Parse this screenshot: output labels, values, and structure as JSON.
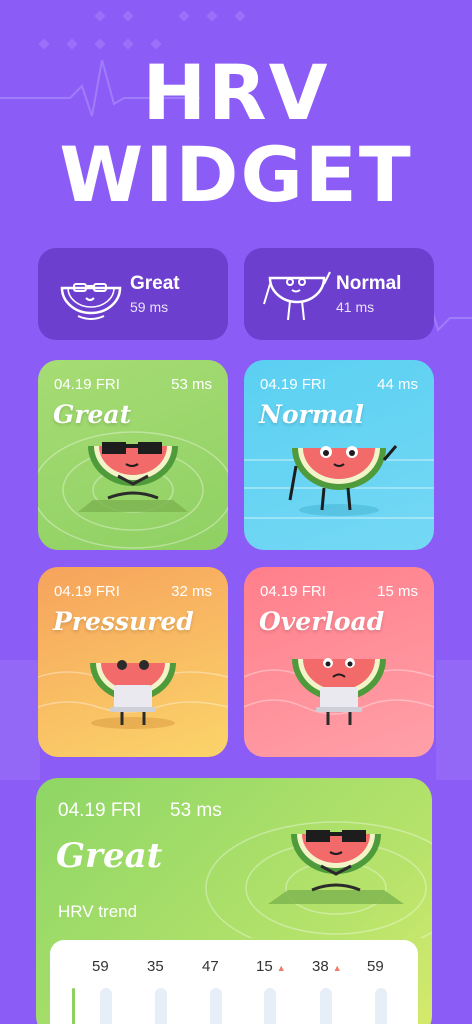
{
  "title_line1": "HRV",
  "title_line2": "WIDGET",
  "summary_cards": [
    {
      "label": "Great",
      "value": "59 ms"
    },
    {
      "label": "Normal",
      "value": "41 ms"
    }
  ],
  "tiles": [
    {
      "date": "04.19 FRI",
      "ms": "53 ms",
      "status": "Great"
    },
    {
      "date": "04.19 FRI",
      "ms": "44 ms",
      "status": "Normal"
    },
    {
      "date": "04.19 FRI",
      "ms": "32 ms",
      "status": "Pressured"
    },
    {
      "date": "04.19 FRI",
      "ms": "15 ms",
      "status": "Overload"
    }
  ],
  "large_widget": {
    "date": "04.19 FRI",
    "ms": "53 ms",
    "status": "Great",
    "trend_label": "HRV trend",
    "trend_values": [
      "59",
      "35",
      "47",
      "15",
      "38",
      "59"
    ],
    "trend_up_markers": [
      false,
      false,
      false,
      true,
      true,
      false
    ]
  },
  "colors": {
    "background": "#8b5cf6",
    "card_dark": "#6d3fcf",
    "great": "#8fd063",
    "normal": "#5bd0f2",
    "pressured": "#f6a35c",
    "overload": "#ff7f8b"
  }
}
